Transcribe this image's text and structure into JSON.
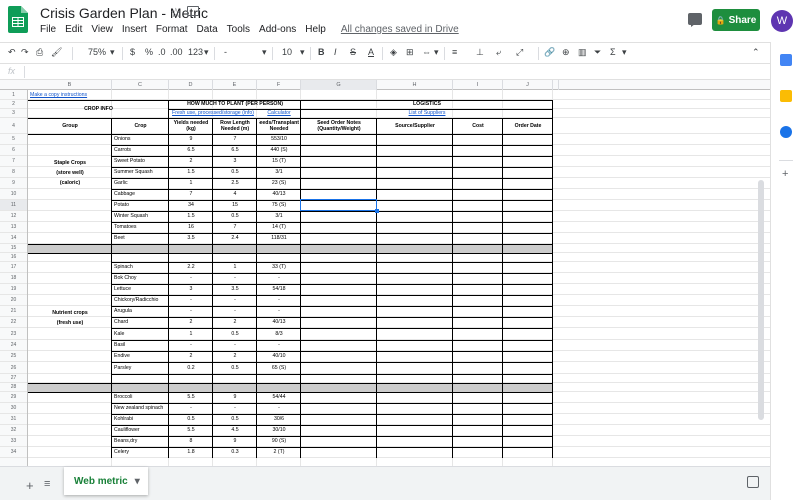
{
  "app": {
    "title": "Crisis Garden Plan - Metric",
    "saved_status": "All changes saved in Drive",
    "share_label": "Share",
    "avatar_letter": "W",
    "brand_color": "#0f9d58"
  },
  "menu": [
    "File",
    "Edit",
    "View",
    "Insert",
    "Format",
    "Data",
    "Tools",
    "Add-ons",
    "Help"
  ],
  "toolbar": {
    "zoom": "75%",
    "currency": "$",
    "percent": "%",
    "dec1": ".0",
    "dec2": ".00",
    "format": "123",
    "font_size": "10",
    "bold": "B",
    "italic": "I",
    "strike": "S",
    "textcolor": "A",
    "sum": "Σ"
  },
  "formula_bar": {
    "fx": "fx",
    "value": ""
  },
  "columns": [
    "A",
    "B",
    "C",
    "D",
    "E",
    "F",
    "G",
    "H",
    "I",
    "J",
    ""
  ],
  "rows": [
    "1",
    "2",
    "3",
    "4",
    "5",
    "6",
    "7",
    "8",
    "9",
    "10",
    "11",
    "12",
    "13",
    "14",
    "15",
    "16",
    "17",
    "18",
    "19",
    "20",
    "21",
    "22",
    "23",
    "24",
    "25",
    "26",
    "27",
    "28",
    "29",
    "30",
    "31",
    "32",
    "33",
    "34"
  ],
  "sheet": {
    "copy_link": "Make a copy instructions",
    "crop_info": "CROP INFO",
    "how_much": "HOW MUCH TO PLANT (PER PERSON)",
    "logistics": "LOGISTICS",
    "fresh_link": "Fresh use, processed/storage (info)",
    "calc_link": "Calculator",
    "suppliers_link": "List of Suppliers",
    "headers": [
      "Group",
      "Crop",
      "Yields needed (kg)",
      "Row Length Needed (m)",
      "Seeds/Transplants Needed",
      "Seed Order Notes (Quantity/Weight)",
      "Source/Supplier",
      "Cost",
      "Order Date"
    ],
    "group1": [
      "Staple Crops",
      "(store well)",
      "(caloric)"
    ],
    "group2": [
      "Nutrient crops",
      "(fresh use)"
    ],
    "data": [
      [
        "Onions",
        "9",
        "7",
        "553/10"
      ],
      [
        "Carrots",
        "6.5",
        "6.5",
        "440 (S)"
      ],
      [
        "Sweet Potato",
        "2",
        "3",
        "15 (T)"
      ],
      [
        "Summer Squash",
        "1.5",
        "0.5",
        "3/1"
      ],
      [
        "Garlic",
        "1",
        "2.5",
        "23 (S)"
      ],
      [
        "Cabbage",
        "7",
        "4",
        "40/13"
      ],
      [
        "Potato",
        "34",
        "15",
        "75 (S)"
      ],
      [
        "Winter Squash",
        "1.5",
        "0.5",
        "3/1"
      ],
      [
        "Tomatoes",
        "16",
        "7",
        "14 (T)"
      ],
      [
        "Beet",
        "3.5",
        "2.4",
        "118/31"
      ],
      [
        "Spinach",
        "2.2",
        "1",
        "33 (T)"
      ],
      [
        "Bok Choy",
        "-",
        "-",
        "-"
      ],
      [
        "Lettuce",
        "3",
        "3.5",
        "54/18"
      ],
      [
        "Chickory/Radicchio",
        "-",
        "-",
        "-"
      ],
      [
        "Arugula",
        "-",
        "-",
        "-"
      ],
      [
        "Chard",
        "2",
        "2",
        "40/13"
      ],
      [
        "Kale",
        "1",
        "0.5",
        "8/3"
      ],
      [
        "Basil",
        "-",
        "-",
        "-"
      ],
      [
        "Endive",
        "2",
        "2",
        "40/10"
      ],
      [
        "Parsley",
        "0.2",
        "0.5",
        "65 (S)"
      ],
      [
        "Broccoli",
        "5.5",
        "9",
        "54/44"
      ],
      [
        "New zealand spinach",
        "-",
        "-",
        "-"
      ],
      [
        "Kohlrabi",
        "0.5",
        "0.5",
        "30/6"
      ],
      [
        "Cauliflower",
        "5.5",
        "4.5",
        "30/10"
      ],
      [
        "Beans,dry",
        "8",
        "9",
        "90 (S)"
      ],
      [
        "Celery",
        "1.8",
        "0.3",
        "2 (T)"
      ]
    ]
  },
  "tabs": {
    "active": "Web metric"
  },
  "side_icons": [
    "calendar-icon",
    "keep-icon",
    "tasks-icon"
  ]
}
